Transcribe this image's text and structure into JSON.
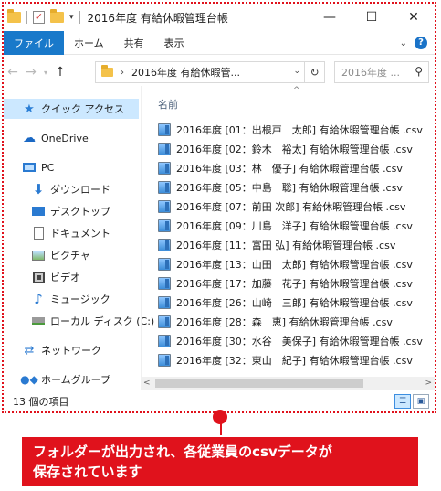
{
  "window": {
    "title": "2016年度 有給休暇管理台帳",
    "controls": [
      "—",
      "☐",
      "✕"
    ]
  },
  "ribbon": {
    "tabs": [
      "ファイル",
      "ホーム",
      "共有",
      "表示"
    ]
  },
  "address": {
    "crumb": "2016年度 有給休暇管...",
    "search_placeholder": "2016年度 ..."
  },
  "nav_pane": {
    "items": [
      {
        "label": "クイック アクセス",
        "icon": "star-icon"
      },
      {
        "label": "OneDrive",
        "icon": "cloud-icon"
      },
      {
        "label": "PC",
        "icon": "computer-icon"
      },
      {
        "label": "ダウンロード",
        "icon": "download-icon"
      },
      {
        "label": "デスクトップ",
        "icon": "desktop-icon"
      },
      {
        "label": "ドキュメント",
        "icon": "document-icon"
      },
      {
        "label": "ピクチャ",
        "icon": "picture-icon"
      },
      {
        "label": "ビデオ",
        "icon": "video-icon"
      },
      {
        "label": "ミュージック",
        "icon": "music-icon"
      },
      {
        "label": "ローカル ディスク (C:)",
        "icon": "disk-icon"
      },
      {
        "label": "ネットワーク",
        "icon": "network-icon"
      },
      {
        "label": "ホームグループ",
        "icon": "homegroup-icon"
      }
    ]
  },
  "files": {
    "column_header": "名前",
    "items": [
      "2016年度 [01：出根戸　太郎] 有給休暇管理台帳 .csv",
      "2016年度 [02：鈴木　裕太] 有給休暇管理台帳 .csv",
      "2016年度 [03：林　優子] 有給休暇管理台帳 .csv",
      "2016年度 [05：中島　聡] 有給休暇管理台帳 .csv",
      "2016年度 [07：前田 次郎] 有給休暇管理台帳 .csv",
      "2016年度 [09：川島　洋子] 有給休暇管理台帳 .csv",
      "2016年度 [11：富田 弘] 有給休暇管理台帳 .csv",
      "2016年度 [13：山田　太郎] 有給休暇管理台帳 .csv",
      "2016年度 [17：加藤　花子] 有給休暇管理台帳 .csv",
      "2016年度 [26：山崎　三郎] 有給休暇管理台帳 .csv",
      "2016年度 [28：森　恵] 有給休暇管理台帳 .csv",
      "2016年度 [30：水谷　美保子] 有給休暇管理台帳 .csv",
      "2016年度 [32：東山　紀子] 有給休暇管理台帳 .csv"
    ]
  },
  "status_bar": {
    "item_count": "13 個の項目"
  },
  "callout": {
    "line1": "フォルダーが出力され、各従業員のcsvデータが",
    "line2": "保存されています"
  },
  "colors": {
    "accent": "#1979ca",
    "annotation": "#e0121c",
    "selection": "#cce8ff"
  }
}
